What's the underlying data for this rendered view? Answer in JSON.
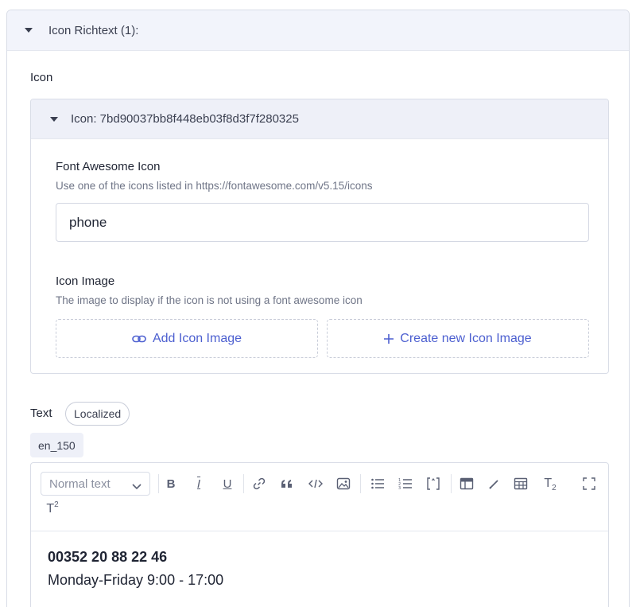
{
  "outer": {
    "title": "Icon Richtext (1):"
  },
  "icon_section": {
    "label": "Icon"
  },
  "icon_panel": {
    "title": "Icon: 7bd90037bb8f448eb03f8d3f7f280325",
    "font_awesome": {
      "label": "Font Awesome Icon",
      "help": "Use one of the icons listed in https://fontawesome.com/v5.15/icons",
      "value": "phone"
    },
    "icon_image": {
      "label": "Icon Image",
      "help": "The image to display if the icon is not using a font awesome icon",
      "add_button": "Add Icon Image",
      "create_button": "Create new Icon Image"
    }
  },
  "text_section": {
    "label": "Text",
    "badge": "Localized",
    "locale": "en_150"
  },
  "editor": {
    "format_select": "Normal text",
    "toolbar": {
      "bold": "B",
      "italic": "I",
      "underline": "U",
      "subscript": "T",
      "subscript_mark": "2",
      "superscript": "T",
      "superscript_mark": "2"
    },
    "content": {
      "line1": "00352 20 88 22 46",
      "line2": "Monday-Friday 9:00 - 17:00"
    }
  },
  "colors": {
    "accent": "#4c5fd0",
    "header_bg": "#f2f4fb",
    "border": "#d9dde7"
  }
}
